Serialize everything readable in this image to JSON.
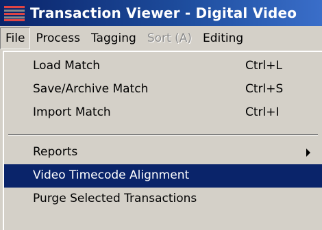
{
  "window": {
    "title": "Transaction Viewer - Digital Video"
  },
  "menubar": {
    "items": [
      {
        "label": "File"
      },
      {
        "label": "Process"
      },
      {
        "label": "Tagging"
      },
      {
        "label": "Sort (A)"
      },
      {
        "label": "Editing"
      }
    ]
  },
  "file_menu": {
    "items": [
      {
        "label": "Load Match",
        "shortcut": "Ctrl+L"
      },
      {
        "label": "Save/Archive Match",
        "shortcut": "Ctrl+S"
      },
      {
        "label": "Import Match",
        "shortcut": "Ctrl+I"
      },
      {
        "label": "Reports",
        "submenu_icon": "chevron-right-icon"
      },
      {
        "label": "Video Timecode Alignment"
      },
      {
        "label": "Purge Selected Transactions"
      }
    ]
  },
  "colors": {
    "titlebar": "#0a246a",
    "highlight": "#0a246a",
    "menu_bg": "#d4d0c8",
    "disabled_text": "#8c8c8c"
  }
}
